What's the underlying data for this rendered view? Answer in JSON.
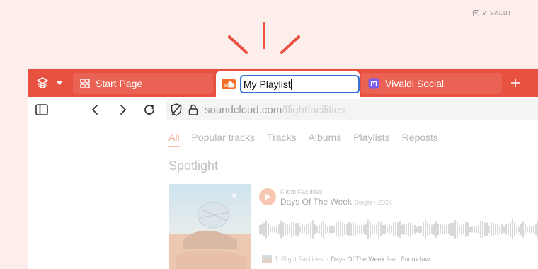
{
  "brand": {
    "watermark": "VIVALDI"
  },
  "tabs": [
    {
      "label": "Start Page",
      "icon": "grid-icon"
    },
    {
      "label": "My Playlist",
      "icon": "soundcloud-icon",
      "editing": true
    },
    {
      "label": "Vivaldi Social",
      "icon": "mastodon-icon"
    }
  ],
  "addressbar": {
    "domain": "soundcloud.com",
    "path": "/flightfacilities"
  },
  "page": {
    "nav": [
      "All",
      "Popular tracks",
      "Tracks",
      "Albums",
      "Playlists",
      "Reposts"
    ],
    "section_title": "Spotlight",
    "artist": "Flight Facilities",
    "track_title": "Days Of The Week",
    "track_meta": "Single · 2024",
    "comment_count": "1",
    "comment_user": "Flight Facilities",
    "comment_sep": " · ",
    "comment_track": "Days Of The Week feat. Enumclaw"
  },
  "colors": {
    "tabbar": "#e8503f",
    "tab": "#ea6253",
    "accent": "#f3a98c",
    "focus": "#3b6fd8"
  }
}
